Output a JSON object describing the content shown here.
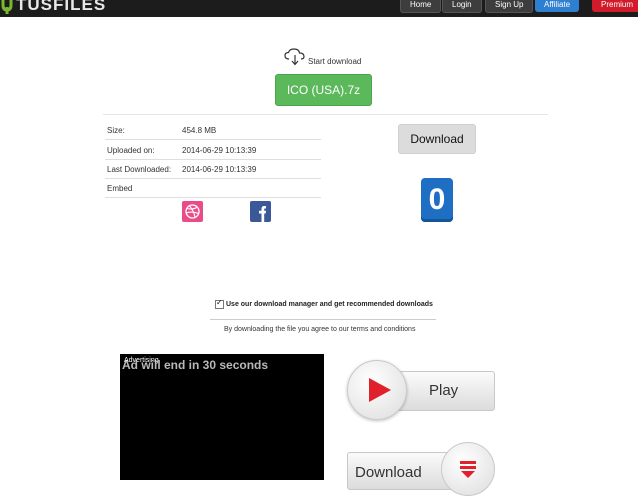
{
  "header": {
    "logo_text": "TUSFILES",
    "nav": {
      "home": "Home",
      "login": "Login",
      "signup": "Sign Up",
      "affiliate": "Affiliate",
      "premium": "Premium"
    },
    "colors": {
      "bar": "#1c1c1c",
      "affiliate": "#2f7fd0",
      "premium": "#d11a2a"
    }
  },
  "download": {
    "start_label": "Start download",
    "file_name": "ICO (USA).7z",
    "button_label": "Download",
    "counter": "0",
    "colors": {
      "file_button": "#5bb95b",
      "counter": "#1e6fc4"
    }
  },
  "info": {
    "size_label": "Size:",
    "size_value": "454.8 MB",
    "uploaded_label": "Uploaded on:",
    "uploaded_value": "2014-06-29 10:13:39",
    "last_label": "Last Downloaded:",
    "last_value": "2014-06-29 10:13:39",
    "embed_label": "Embed"
  },
  "social": {
    "dribbble": "dribbble-icon",
    "facebook": "facebook-icon"
  },
  "manager": {
    "checkbox_checked": true,
    "checkbox_label": "Use our download manager and get recommended downloads",
    "terms_text": "By downloading the file you agree to our terms and conditions"
  },
  "ad": {
    "label": "Advertising",
    "timer": "Ad will end in 30 seconds"
  },
  "promo": {
    "play_label": "Play",
    "download_label": "Download"
  }
}
